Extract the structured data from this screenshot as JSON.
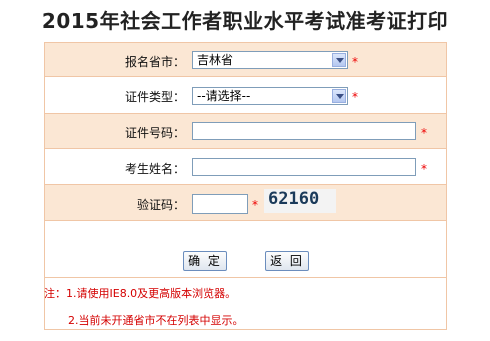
{
  "page_title": "2015年社会工作者职业水平考试准考证打印",
  "form": {
    "province": {
      "label": "报名省市：",
      "value": "吉林省",
      "required": "*"
    },
    "cert_type": {
      "label": "证件类型：",
      "value": "--请选择--",
      "required": "*"
    },
    "cert_number": {
      "label": "证件号码：",
      "value": "",
      "required": "*"
    },
    "name": {
      "label": "考生姓名：",
      "value": "",
      "required": "*"
    },
    "captcha": {
      "label": "验证码：",
      "value": "",
      "required": "*",
      "image_text": "62160"
    }
  },
  "buttons": {
    "confirm": "确 定",
    "back": "返 回"
  },
  "notes": {
    "line1": "注：1.请使用IE8.0及更高版本浏览器。",
    "line2": "2.当前未开通省市不在列表中显示。"
  }
}
